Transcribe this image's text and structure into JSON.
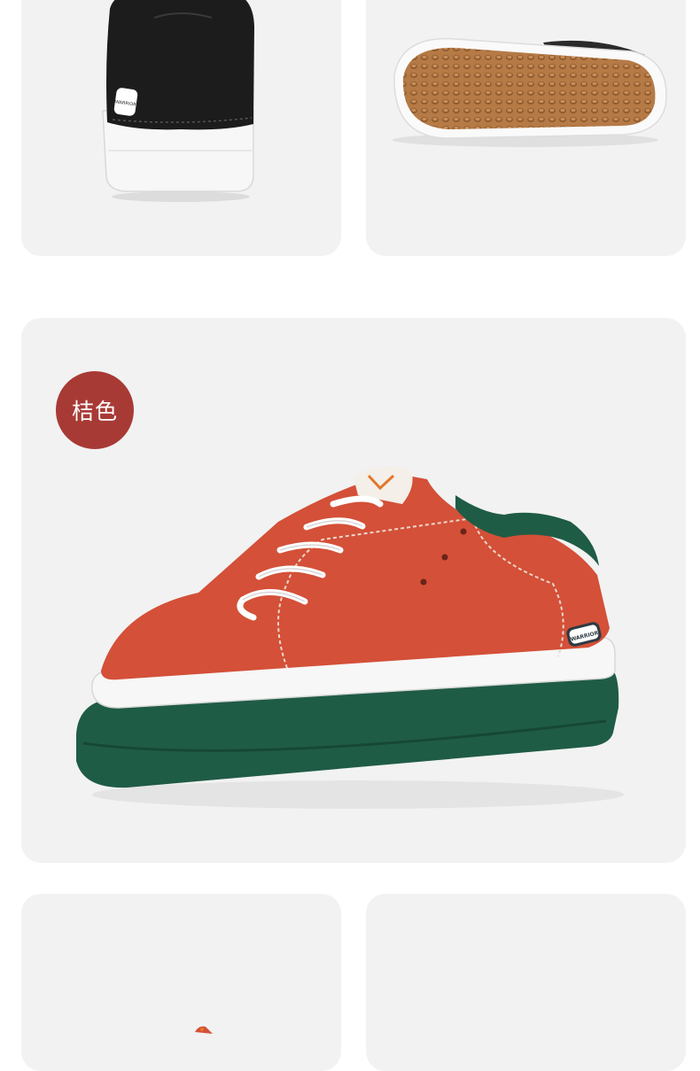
{
  "colors": {
    "card_bg": "#f2f2f2",
    "badge_bg": "#a83a35",
    "suede_orange": "#d45038",
    "sole_green": "#1f5c45",
    "sole_gum": "#b57a45",
    "upper_black": "#1c1c1c"
  },
  "variant": {
    "label": "桔色"
  },
  "images": {
    "back_view": "black-shoe-heel-image",
    "sole_view": "gum-outsole-image",
    "main_view": "orange-shoe-side-image",
    "bottom_left": "shoe-partial-image",
    "bottom_right": "shoe-partial-image"
  },
  "brand": {
    "heel_tab": "WARRIOR",
    "side_tab": "WARRIOR"
  }
}
